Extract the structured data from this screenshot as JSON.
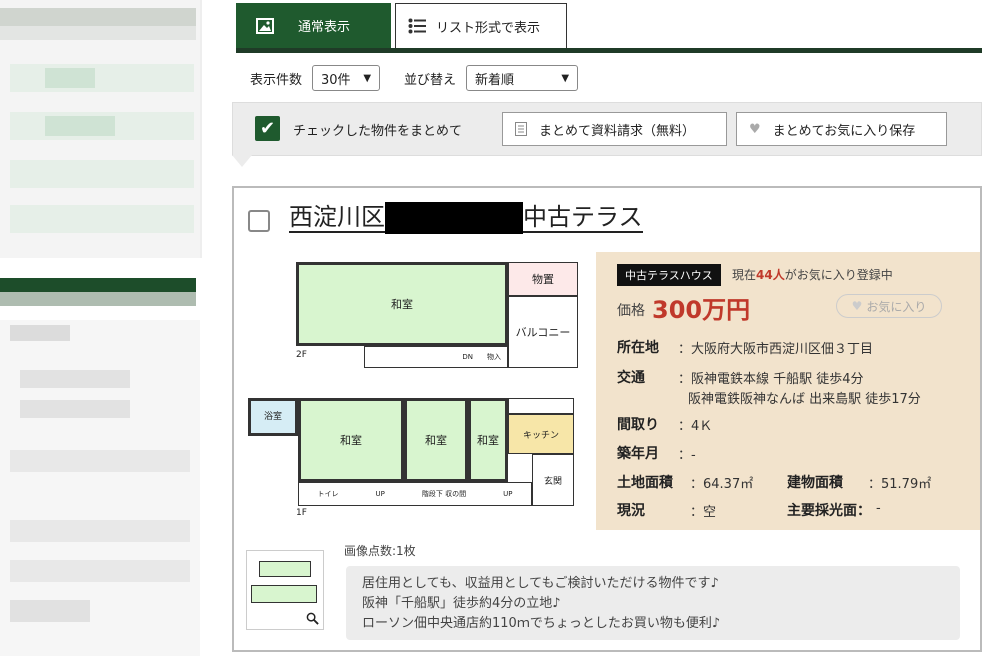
{
  "tabs": {
    "normal": "通常表示",
    "list": "リスト形式で表示"
  },
  "controls": {
    "count_label": "表示件数",
    "count_value": "30件",
    "sort_label": "並び替え",
    "sort_value": "新着順"
  },
  "batch": {
    "label": "チェックした物件をまとめて",
    "request_button": "まとめて資料請求（無料）",
    "favorite_button": "まとめてお気に入り保存"
  },
  "listing": {
    "title_prefix": "西淀川区",
    "title_suffix": "中古テラス",
    "floorplan_labels": {
      "wasitsu": "和室",
      "monooki": "物置",
      "balcony": "バルコニー",
      "floor2": "2F",
      "floor1": "1F",
      "yokushitsu": "浴室",
      "kitchen": "キッチン",
      "genkan": "玄関",
      "toilet": "トイレ",
      "stairs": "階段下\n収の間",
      "up": "UP",
      "dn": "DN",
      "fukiire": "物入",
      "shita": "下駄箱"
    },
    "badge": "中古テラスハウス",
    "favorite_prefix": "現在",
    "favorite_count": "44人",
    "favorite_suffix": "がお気に入り登録中",
    "price_label": "価格",
    "price": "300万円",
    "favorite_button": "お気に入り",
    "address_label": "所在地",
    "address": "：大阪府大阪市西淀川区佃３丁目",
    "access_label": "交通",
    "access_1": "：阪神電鉄本線 千船駅 徒歩4分",
    "access_2": "阪神電鉄阪神なんば 出来島駅 徒歩17分",
    "layout_label": "間取り",
    "layout": "：4Ｋ",
    "built_label": "築年月",
    "built": "：-",
    "land_label": "土地面積",
    "land": "：64.37㎡",
    "building_label": "建物面積",
    "building": "：51.79㎡",
    "status_label": "現況",
    "status": "：空",
    "light_label": "主要採光面：",
    "light": "-",
    "image_count": "画像点数:1枚",
    "description": [
      "居住用としても、収益用としてもご検討いただける物件です♪",
      "阪神「千船駅」徒歩約4分の立地♪",
      "ローソン佃中央通店約110ｍでちょっとしたお買い物も便利♪"
    ]
  },
  "colors": {
    "brand_green": "#1f5a2e",
    "price_red": "#c0392b",
    "info_bg": "#f2e3cc"
  }
}
